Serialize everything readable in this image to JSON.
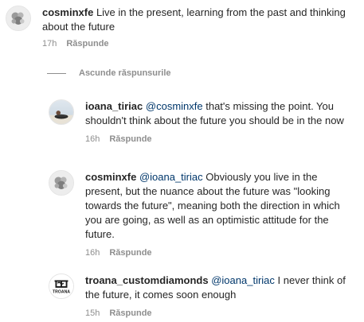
{
  "comments": [
    {
      "username": "cosminxfe",
      "mention": "",
      "text": "Live in the present, learning from the past and thinking about the future",
      "time": "17h",
      "reply_label": "Răspunde",
      "avatar_icon": "gray-cluster-avatar-icon"
    }
  ],
  "hide_replies_label": "Ascunde răspunsurile",
  "replies": [
    {
      "username": "ioana_tiriac",
      "mention": "@cosminxfe",
      "text": "that's missing the point. You shouldn't think about the future you should be in the now",
      "time": "16h",
      "reply_label": "Răspunde",
      "avatar_icon": "beach-photo-avatar-icon"
    },
    {
      "username": "cosminxfe",
      "mention": "@ioana_tiriac",
      "text": "Obviously you live in the present, but the nuance about the future was \"looking towards the future\", meaning both the direction in which you are going, as well as an optimistic attitude for the future.",
      "time": "16h",
      "reply_label": "Răspunde",
      "avatar_icon": "gray-cluster-avatar-icon"
    },
    {
      "username": "troana_customdiamonds",
      "mention": "@ioana_tiriac",
      "text": "I never think of the future, it comes soon enough",
      "time": "15h",
      "reply_label": "Răspunde",
      "avatar_icon": "troana-logo-avatar-icon",
      "logo_text": "TROANA"
    }
  ],
  "colors": {
    "text": "#262626",
    "muted": "#8e8e8e",
    "mention": "#00376b"
  }
}
